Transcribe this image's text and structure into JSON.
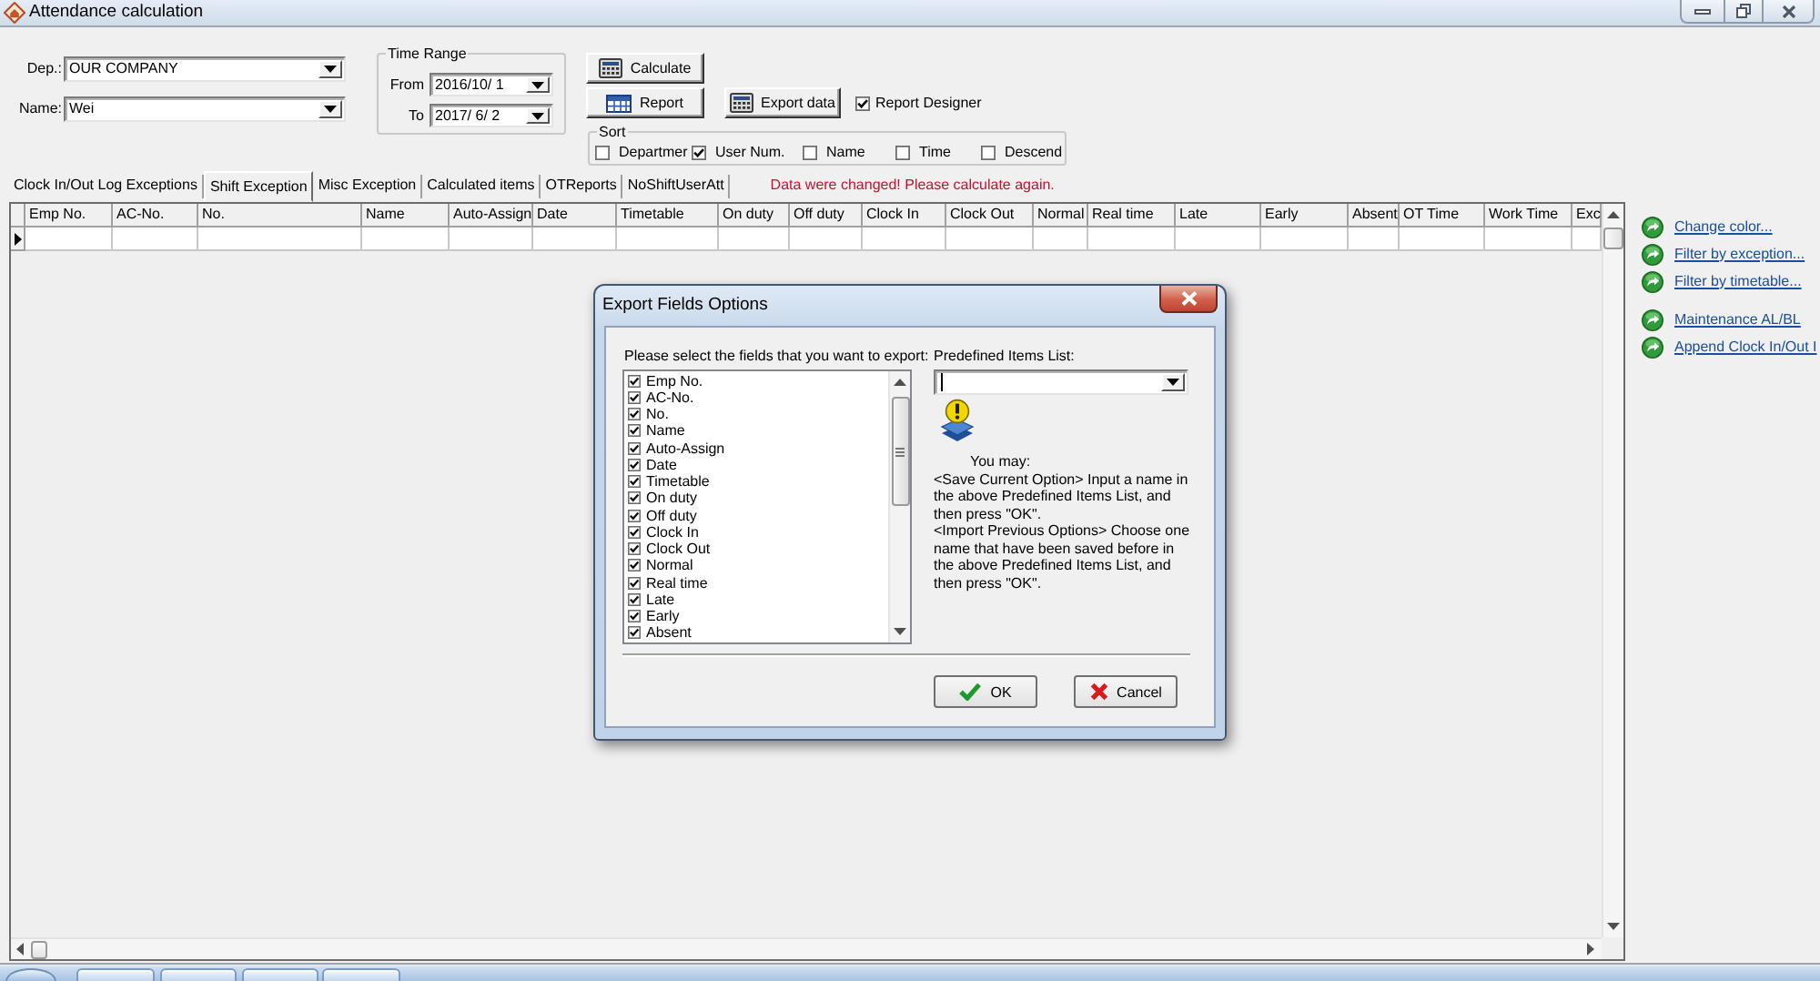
{
  "window": {
    "title": "Attendance calculation"
  },
  "filters": {
    "department": {
      "label": "Dep.:",
      "value": "OUR COMPANY"
    },
    "employee": {
      "label": "Name:",
      "value": "Wei"
    }
  },
  "time_range": {
    "title": "Time Range",
    "from": {
      "label": "From",
      "value": "2016/10/ 1"
    },
    "to": {
      "label": "To",
      "value": "2017/ 6/ 2"
    }
  },
  "actions": [
    {
      "kind": "calculate",
      "label": "Calculate"
    },
    {
      "kind": "report",
      "label": "Report"
    },
    {
      "kind": "export",
      "label": "Export data"
    }
  ],
  "report_designer": {
    "label": "Report Designer",
    "checked": true
  },
  "sort": {
    "title": "Sort",
    "options": [
      {
        "label": "Departmer",
        "checked": false
      },
      {
        "label": "User Num.",
        "checked": true
      },
      {
        "label": "Name",
        "checked": false
      },
      {
        "label": "Time",
        "checked": false
      },
      {
        "label": "Descend",
        "checked": false
      }
    ]
  },
  "tabs": [
    {
      "label": "Clock In/Out Log Exceptions",
      "selected": false
    },
    {
      "label": "Shift Exception",
      "selected": true
    },
    {
      "label": "Misc Exception",
      "selected": false
    },
    {
      "label": "Calculated items",
      "selected": false
    },
    {
      "label": "OTReports",
      "selected": false
    },
    {
      "label": "NoShiftUserAtt",
      "selected": false
    }
  ],
  "status_message": "Data were changed! Please calculate again.",
  "table": {
    "columns": [
      "Emp No.",
      "AC-No.",
      "No.",
      "Name",
      "Auto-Assign",
      "Date",
      "Timetable",
      "On duty",
      "Off duty",
      "Clock In",
      "Clock Out",
      "Normal",
      "Real time",
      "Late",
      "Early",
      "Absent",
      "OT Time",
      "Work Time",
      "Exc"
    ],
    "rows": [
      {
        "current": true
      }
    ]
  },
  "side_panel": {
    "link_groups": [
      {
        "links": [
          "Change color...",
          "Filter by exception...",
          "Filter by timetable..."
        ]
      },
      {
        "links": [
          "Maintenance AL/BL",
          "Append Clock In/Out I"
        ]
      }
    ]
  },
  "dialog": {
    "title": "Export Fields Options",
    "fields_prompt": "Please select the fields that you want to export:",
    "fields": [
      {
        "label": "Emp No.",
        "checked": true
      },
      {
        "label": "AC-No.",
        "checked": true
      },
      {
        "label": "No.",
        "checked": true
      },
      {
        "label": "Name",
        "checked": true
      },
      {
        "label": "Auto-Assign",
        "checked": true
      },
      {
        "label": "Date",
        "checked": true
      },
      {
        "label": "Timetable",
        "checked": true
      },
      {
        "label": "On duty",
        "checked": true
      },
      {
        "label": "Off duty",
        "checked": true
      },
      {
        "label": "Clock In",
        "checked": true
      },
      {
        "label": "Clock Out",
        "checked": true
      },
      {
        "label": "Normal",
        "checked": true
      },
      {
        "label": "Real time",
        "checked": true
      },
      {
        "label": "Late",
        "checked": true
      },
      {
        "label": "Early",
        "checked": true
      },
      {
        "label": "Absent",
        "checked": true
      }
    ],
    "predefined_list": {
      "label": "Predefined Items List:",
      "focused": true
    },
    "hint_title": "You may:",
    "hint_paragraphs": [
      "<Save Current Option> Input a name in the above Predefined Items List, and then press \"OK\".",
      "<Import Previous Options> Choose one name that have been saved before in the above Predefined Items List, and then press \"OK\"."
    ],
    "buttons": [
      {
        "kind": "ok",
        "label": "OK"
      },
      {
        "kind": "cancel",
        "label": "Cancel"
      }
    ]
  }
}
